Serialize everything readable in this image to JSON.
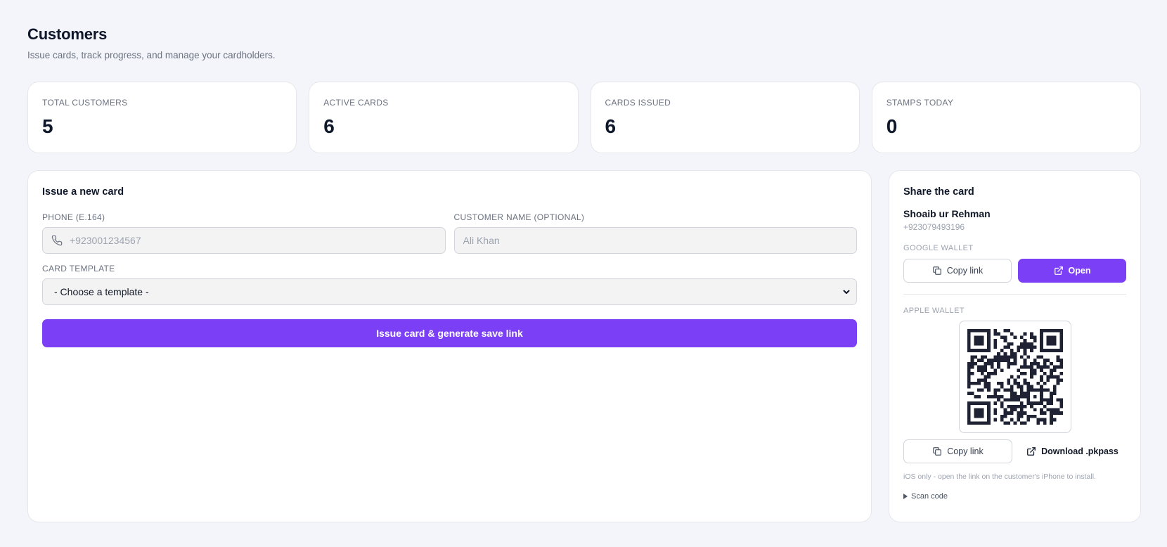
{
  "header": {
    "title": "Customers",
    "subtitle": "Issue cards, track progress, and manage your cardholders."
  },
  "stats": [
    {
      "label": "TOTAL CUSTOMERS",
      "value": "5"
    },
    {
      "label": "ACTIVE CARDS",
      "value": "6"
    },
    {
      "label": "CARDS ISSUED",
      "value": "6"
    },
    {
      "label": "STAMPS TODAY",
      "value": "0"
    }
  ],
  "issue_form": {
    "title": "Issue a new card",
    "phone_label": "PHONE (E.164)",
    "phone_placeholder": "+923001234567",
    "phone_value": "",
    "name_label": "CUSTOMER NAME (OPTIONAL)",
    "name_placeholder": "Ali Khan",
    "name_value": "",
    "template_label": "CARD TEMPLATE",
    "template_selected": "- Choose a template -",
    "submit_label": "Issue card & generate save link"
  },
  "share": {
    "title": "Share the card",
    "customer_name": "Shoaib ur Rehman",
    "customer_phone": "+923079493196",
    "google_wallet_label": "GOOGLE WALLET",
    "google_copy_label": "Copy link",
    "google_open_label": "Open",
    "apple_wallet_label": "APPLE WALLET",
    "apple_copy_label": "Copy link",
    "apple_download_label": "Download .pkpass",
    "ios_note": "iOS only - open the link on the customer's iPhone to install.",
    "scan_code_label": "Scan code"
  },
  "icons": {
    "phone": "phone-icon",
    "copy": "copy-icon",
    "external": "external-link-icon",
    "chevron": "chevron-down-icon",
    "disclosure": "disclosure-triangle-icon"
  },
  "colors": {
    "accent": "#7b3ff5",
    "background": "#f4f5fa",
    "qr": "#1e2233"
  }
}
